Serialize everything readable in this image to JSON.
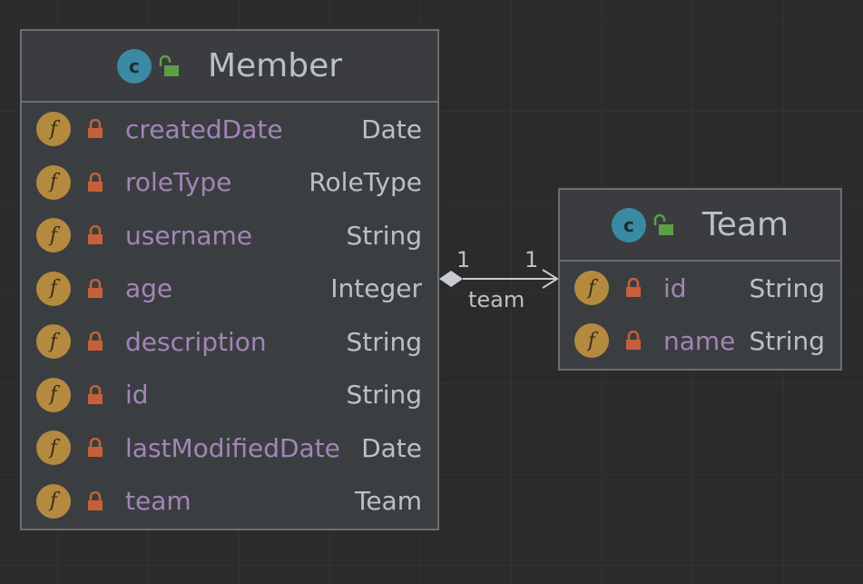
{
  "diagram": {
    "nodes": [
      {
        "id": "member",
        "title": "Member",
        "icon": "class-icon",
        "fields": [
          {
            "name": "createdDate",
            "type": "Date"
          },
          {
            "name": "roleType",
            "type": "RoleType"
          },
          {
            "name": "username",
            "type": "String"
          },
          {
            "name": "age",
            "type": "Integer"
          },
          {
            "name": "description",
            "type": "String"
          },
          {
            "name": "id",
            "type": "String"
          },
          {
            "name": "lastModifiedDate",
            "type": "Date"
          },
          {
            "name": "team",
            "type": "Team"
          }
        ]
      },
      {
        "id": "team",
        "title": "Team",
        "icon": "class-icon",
        "fields": [
          {
            "name": "id",
            "type": "String"
          },
          {
            "name": "name",
            "type": "String"
          }
        ]
      }
    ],
    "edges": [
      {
        "from": "member",
        "to": "team",
        "label": "team",
        "source_multiplicity": "1",
        "target_multiplicity": "1",
        "type": "composition"
      }
    ],
    "class_icon_letter": "c",
    "field_icon_letter": "f"
  },
  "colors": {
    "background": "#2b2b2b",
    "node_fill": "#3b3e41",
    "node_border": "#6c6f72",
    "class_icon": "#3a8aa4",
    "field_icon": "#b38a3f",
    "lock": "#c5603a",
    "unlock": "#5c9f46",
    "field_name": "#a285b8",
    "text": "#b9c1c8"
  }
}
